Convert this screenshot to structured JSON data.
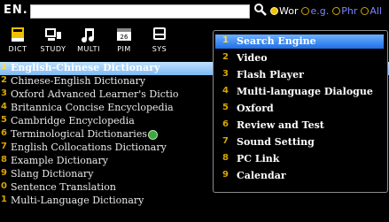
{
  "topbar": {
    "language": "EN.",
    "search_value": "",
    "options": [
      {
        "label": "Wor",
        "selected": true
      },
      {
        "label": "e.g.",
        "selected": false
      },
      {
        "label": "Phr",
        "selected": false
      },
      {
        "label": "All",
        "selected": false
      }
    ]
  },
  "categories": [
    {
      "label": "DICT",
      "icon": "book-icon"
    },
    {
      "label": "STUDY",
      "icon": "study-icon"
    },
    {
      "label": "MULTI",
      "icon": "music-note-icon"
    },
    {
      "label": "PIM",
      "icon": "calendar-icon"
    },
    {
      "label": "SYS",
      "icon": "system-icon"
    }
  ],
  "dictionaries": [
    {
      "num": "1",
      "label": "English-Chinese Dictionary",
      "selected": true
    },
    {
      "num": "2",
      "label": "Chinese-English Dictionary"
    },
    {
      "num": "3",
      "label": "Oxford Advanced Learner's Dictio"
    },
    {
      "num": "4",
      "label": "Britannica Concise Encyclopedia"
    },
    {
      "num": "5",
      "label": "Cambridge Encyclopedia"
    },
    {
      "num": "6",
      "label": "Terminological Dictionaries"
    },
    {
      "num": "7",
      "label": "English Collocations Dictionary"
    },
    {
      "num": "8",
      "label": "Example Dictionary"
    },
    {
      "num": "9",
      "label": "Slang Dictionary"
    },
    {
      "num": "0",
      "label": "Sentence Translation"
    },
    {
      "num": "1",
      "label": "Multi-Language Dictionary"
    }
  ],
  "menu": [
    {
      "num": "1",
      "label": "Search Engine",
      "selected": true
    },
    {
      "num": "2",
      "label": "Video"
    },
    {
      "num": "3",
      "label": "Flash Player"
    },
    {
      "num": "4",
      "label": "Multi-language Dialogue"
    },
    {
      "num": "5",
      "label": "Oxford"
    },
    {
      "num": "6",
      "label": "Review and Test"
    },
    {
      "num": "7",
      "label": "Sound Setting"
    },
    {
      "num": "8",
      "label": "PC Link"
    },
    {
      "num": "9",
      "label": "Calendar"
    }
  ],
  "colors": {
    "background": "#000000",
    "selection_list": "#9bcfff",
    "selection_menu": "#2a7df0",
    "number": "#d8a600",
    "radio_text": "#7a86ff"
  }
}
